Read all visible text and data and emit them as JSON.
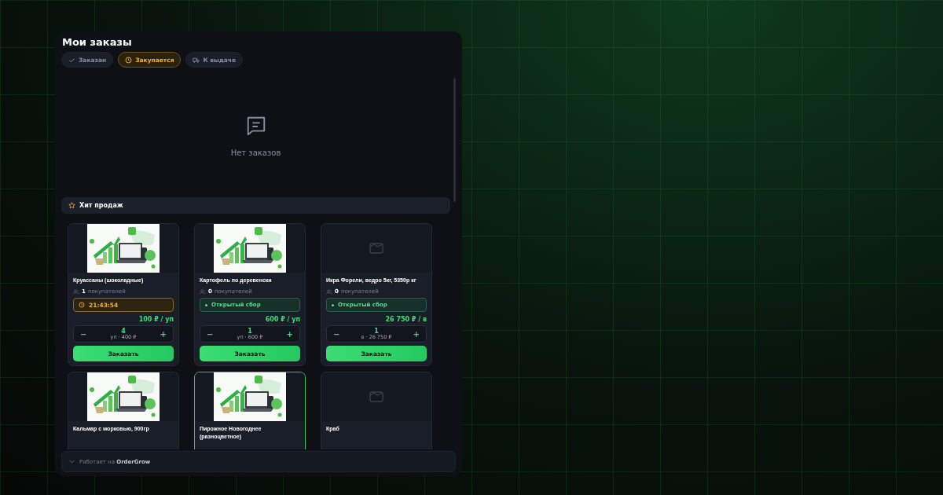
{
  "title": "Мои заказы",
  "tabs": [
    {
      "label": "Заказан",
      "selected": false
    },
    {
      "label": "Закупается",
      "selected": true
    },
    {
      "label": "К выдаче",
      "selected": false
    }
  ],
  "empty_state": {
    "text": "Нет заказов"
  },
  "section": {
    "title": "Хит продаж"
  },
  "products": [
    {
      "kind": "picture",
      "title": "Круассаны (шоколадные)",
      "selected": false,
      "buyers_count": "1",
      "buyers_label": "покупателей",
      "status": {
        "kind": "timer",
        "text": "21:43:54"
      },
      "price": "100 ₽ / уп",
      "minus": "−",
      "quantity": "4",
      "subtotal": "уп · 400 ₽",
      "plus": "+",
      "button": "Заказать"
    },
    {
      "kind": "picture",
      "title": "Картофель по деревенски",
      "selected": false,
      "buyers_count": "0",
      "buyers_label": "покупателей",
      "status": {
        "kind": "open",
        "text": "Открытый сбор"
      },
      "price": "600 ₽ / уп",
      "minus": "−",
      "quantity": "1",
      "subtotal": "уп · 600 ₽",
      "plus": "+",
      "button": "Заказать"
    },
    {
      "kind": "placeholder",
      "title": "Икра Форели, ведро 5кг, 5350р кг",
      "selected": false,
      "buyers_count": "0",
      "buyers_label": "покупателей",
      "status": {
        "kind": "open",
        "text": "Открытый сбор"
      },
      "price": "26 750 ₽ / в",
      "minus": "−",
      "quantity": "1",
      "subtotal": "в · 26 750 ₽",
      "plus": "+",
      "button": "Заказать"
    },
    {
      "kind": "picture",
      "title": "Кальмар с морковью, 900гр",
      "selected": false
    },
    {
      "kind": "picture",
      "title": "Пирожное Новогоднее (разноцветное)",
      "selected": true
    },
    {
      "kind": "placeholder",
      "title": "Краб",
      "selected": false
    }
  ],
  "footer": {
    "text": "Работает на **OrderGrow**"
  }
}
